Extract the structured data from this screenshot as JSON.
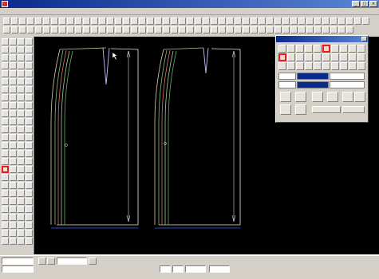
{
  "window": {
    "title": ""
  },
  "menu": [],
  "status": {},
  "palette": {
    "title": "",
    "field_1": "",
    "field_2": "",
    "field_3": "",
    "field_4": ""
  },
  "canvas": {
    "piece_labels": [
      {
        "label": ""
      },
      {
        "label": ""
      }
    ]
  },
  "colors": {
    "canvas_background": "#000000",
    "highlight": "#e02020",
    "title_bar": "#0a2a8c",
    "chrome": "#d4d0c8"
  },
  "icons": [
    "app-icon",
    "tool-icon",
    "select-tool-icon",
    "palette-tool-icon",
    "close-icon"
  ]
}
